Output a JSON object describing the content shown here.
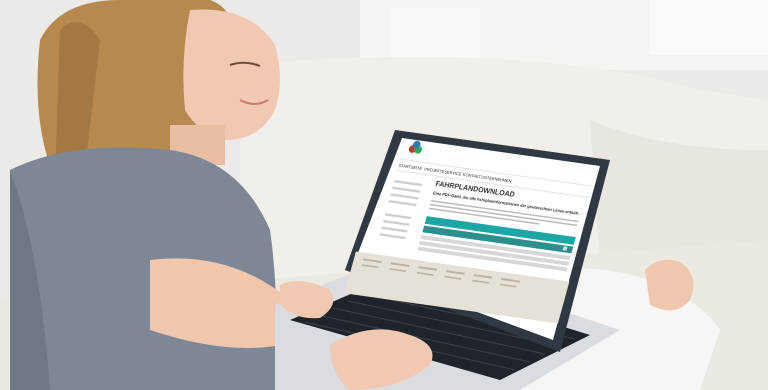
{
  "scene": {
    "description_type": "photo",
    "colors": {
      "wall": "#eceae7",
      "sofa": "#f2efeb",
      "shirt": "#7d8796",
      "skin": "#f1c9b2",
      "hair": "#b8894f",
      "laptop_body": "#d9dde2",
      "laptop_bezel": "#2f3944",
      "screen_bg": "#ffffff",
      "teal": "#1ea6a4",
      "footer": "#e6e1d6"
    }
  },
  "laptop_screen": {
    "nav_items": [
      "STARTSEITE",
      "PROJEKTE",
      "SERVICE",
      "KONTAKT",
      "UNTERNEHMEN"
    ],
    "heading": "FAHRPLANDOWNLOAD",
    "subheading": "Eine PDF-Datei, die alle Fahrplaninformationen der gewünschten Linien enthält."
  }
}
